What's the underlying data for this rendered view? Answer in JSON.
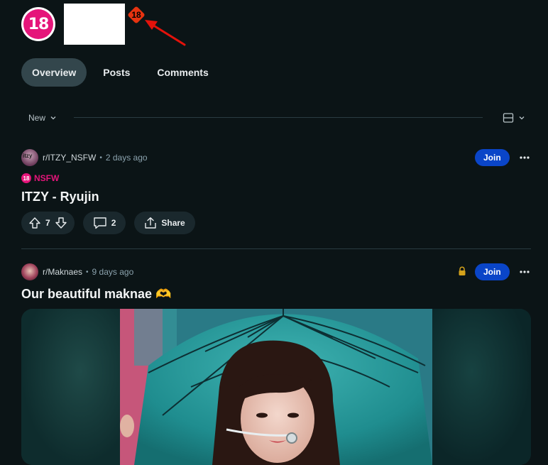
{
  "header": {
    "avatar_text": "18",
    "nsfw_badge_text": "18"
  },
  "tabs": [
    {
      "label": "Overview",
      "active": true
    },
    {
      "label": "Posts",
      "active": false
    },
    {
      "label": "Comments",
      "active": false
    }
  ],
  "sort": {
    "label": "New"
  },
  "posts": [
    {
      "subreddit": "r/ITZY_NSFW",
      "avatar_text": "itzy",
      "dot": "•",
      "time": "2 days ago",
      "join_label": "Join",
      "nsfw_badge": "18",
      "nsfw_label": "NSFW",
      "title": "ITZY - Ryujin",
      "upvotes": "7",
      "comments": "2",
      "share_label": "Share"
    },
    {
      "subreddit": "r/Maknaes",
      "dot": "•",
      "time": "9 days ago",
      "join_label": "Join",
      "title": "Our beautiful maknae 🫶"
    }
  ],
  "colors": {
    "background": "#0b1416",
    "join": "#0a45c8",
    "nsfw": "#e5157a",
    "annotation": "#e3120b",
    "lock": "#d4a21b"
  }
}
